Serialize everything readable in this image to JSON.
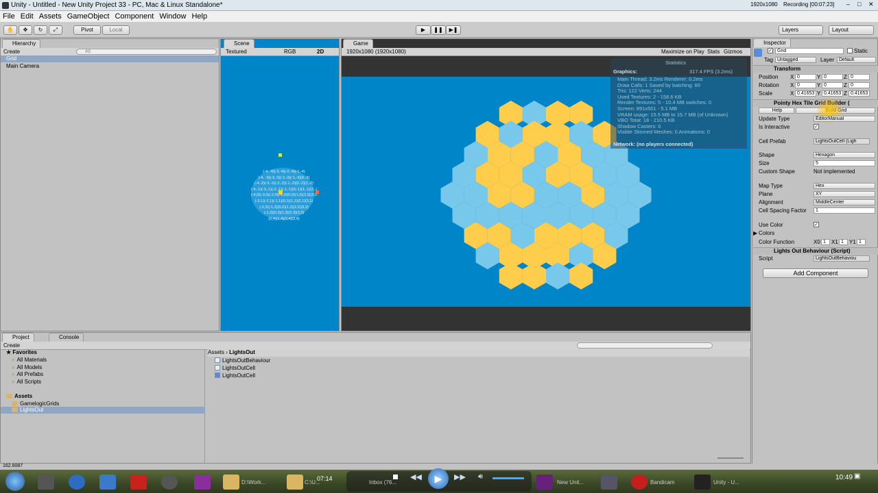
{
  "window": {
    "title": "Unity - Untitled - New Unity Project 33 - PC, Mac & Linux Standalone*",
    "resolution": "1920x1080",
    "recording": "Recording [00:07:23]"
  },
  "menu": [
    "File",
    "Edit",
    "Assets",
    "GameObject",
    "Component",
    "Window",
    "Help"
  ],
  "toolbar": {
    "pivot": "Pivot",
    "local": "Local",
    "layers": "Layers",
    "layout": "Layout"
  },
  "hierarchy": {
    "tab": "Hierarchy",
    "create": "Create",
    "search": "All",
    "items": [
      "Grid",
      "Main Camera"
    ]
  },
  "scene": {
    "tab": "Scene",
    "shading": "Textured",
    "color": "RGB",
    "mode2d": "2D",
    "overlay_text": [
      "(-4, -4)(-3,-4)(-2,-4)(-1,-4)",
      "(-4, -3)(-3,-3)(-2,-3)(-1,-3)(0,-3)",
      "(-4,-2)(-3,-2)(-2,-2)(-1,-2)(0,-2)(1,-2)",
      "(-4,-1)(-3,-1)(-2,-1)(-1,-1)(0,-1)(1,-1)(2,-1)",
      "(-4,0)(-3,0)(-2,0)(-1,0)(0,0)(1,0)(2,0)(3,0)",
      "(-3,1)(-2,1)(-1,1)(0,1)(1,1)(2,1)(3,1)",
      "(-2,2)(-1,2)(0,2)(1,2)(2,2)(3,2)",
      "(-1,3)(0,3)(1,3)(2,3)(3,3)",
      "(0,4)(1,4)(2,4)(3,4)"
    ]
  },
  "game": {
    "tab": "Game",
    "resolution": "1920x1080 (1920x1080)",
    "maximize": "Maximize on Play",
    "stats_btn": "Stats",
    "gizmos": "Gizmos"
  },
  "statistics": {
    "title": "Statistics",
    "graphics_label": "Graphics:",
    "fps": "317.4 FPS (3.2ms)",
    "lines": [
      "Main Thread: 3.2ms  Renderer: 0.2ms",
      "Draw Calls: 1   Saved by batching: 60",
      "Tris: 122  Verts: 244",
      "Used Textures: 2 - 158.6 KB",
      "Render Textures: 5 - 10.4 MB    switches: 0",
      "Screen: 891x501 - 5.1 MB",
      "VRAM usage: 15.5 MB to 15.7 MB (of Unknown)",
      "VBO Total: 18 - 210.5 KB",
      "Shadow Casters: 0",
      "Visible Skinned Meshes: 0       Animations: 0"
    ],
    "network": "Network: (no players connected)"
  },
  "hexgrid": {
    "colors": {
      "yellow": "#fdcd4b",
      "blue": "#78c8eb",
      "background": "#0085c9"
    },
    "rows": [
      {
        "cells": [
          "Y",
          "B",
          "Y",
          "Y"
        ]
      },
      {
        "cells": [
          "Y",
          "B",
          "Y",
          "Y",
          "B",
          "Y"
        ]
      },
      {
        "cells": [
          "B",
          "Y",
          "Y",
          "B",
          "Y",
          "B",
          "B"
        ]
      },
      {
        "cells": [
          "B",
          "Y",
          "Y",
          "B",
          "Y",
          "Y",
          "B",
          "B"
        ]
      },
      {
        "cells": [
          "B",
          "B",
          "Y",
          "Y",
          "B",
          "B",
          "Y",
          "B",
          "B"
        ]
      },
      {
        "cells": [
          "B",
          "B",
          "B",
          "B",
          "B",
          "B",
          "B",
          "B"
        ]
      },
      {
        "cells": [
          "Y",
          "Y",
          "B",
          "Y",
          "Y",
          "Y",
          "B"
        ]
      },
      {
        "cells": [
          "B",
          "Y",
          "Y",
          "Y",
          "B",
          "Y"
        ]
      },
      {
        "cells": [
          "Y",
          "Y",
          "B",
          "Y"
        ]
      }
    ]
  },
  "inspector": {
    "tab": "Inspector",
    "object_name": "Grid",
    "static": "Static",
    "tag_label": "Tag",
    "tag": "Untagged",
    "layer_label": "Layer",
    "layer": "Default",
    "transform": {
      "title": "Transform",
      "position_label": "Position",
      "rotation_label": "Rotation",
      "scale_label": "Scale",
      "position": [
        "0",
        "0",
        "0"
      ],
      "rotation": [
        "0",
        "0",
        "0"
      ],
      "scale": [
        "0.41653",
        "0.41653",
        "0.41653"
      ]
    },
    "builder": {
      "title": "Pointy Hex Tile Grid Builder (",
      "help": "Help",
      "build": "Build Grid",
      "fields": [
        {
          "label": "Update Type",
          "value": "EditorManual",
          "kind": "dd"
        },
        {
          "label": "Is Interactive",
          "value": "✓",
          "kind": "chk"
        },
        {
          "label": "Cell Prefab",
          "value": "LightsOutCell (Ligh",
          "kind": "obj"
        },
        {
          "label": "Shape",
          "value": "Hexagon",
          "kind": "dd"
        },
        {
          "label": "Size",
          "value": "5",
          "kind": "field"
        },
        {
          "label": "Custom Shape",
          "value": "Not implemented",
          "kind": "text"
        },
        {
          "label": "Map Type",
          "value": "Hex",
          "kind": "dd"
        },
        {
          "label": "Plane",
          "value": "XY",
          "kind": "dd"
        },
        {
          "label": "Alignment",
          "value": "MiddleCenter",
          "kind": "dd"
        },
        {
          "label": "Cell Spacing Factor",
          "value": "1",
          "kind": "field"
        },
        {
          "label": "Use Color",
          "value": "✓",
          "kind": "chk"
        },
        {
          "label": "Colors",
          "value": "",
          "kind": "fold"
        }
      ],
      "color_function_label": "Color Function",
      "color_function": [
        "X0",
        "1",
        "X1",
        "1",
        "Y1",
        "1"
      ]
    },
    "behaviour": {
      "title": "Lights Out Behaviour (Script)",
      "script_label": "Script",
      "script": "LightsOutBehaviou"
    },
    "add_component": "Add Component"
  },
  "project": {
    "tab": "Project",
    "console_tab": "Console",
    "create": "Create",
    "favorites_label": "Favorites",
    "favorites": [
      "All Materials",
      "All Models",
      "All Prefabs",
      "All Scripts"
    ],
    "assets_label": "Assets",
    "folders": [
      "GamelogicGrids",
      "LightsOut"
    ],
    "breadcrumb": [
      "Assets",
      "LightsOut"
    ],
    "files": [
      "LightsOutBehaviour",
      "LightsOutCell",
      "LightsOutCell"
    ]
  },
  "status": {
    "coords": "162.6087"
  },
  "taskbar": {
    "time": "07:14",
    "clock": "10:49",
    "items": [
      "D:\\Work...",
      "C:\\U...",
      "Inbox (76...",
      "New Unit...",
      "Bandicam",
      "Unity - U..."
    ]
  }
}
